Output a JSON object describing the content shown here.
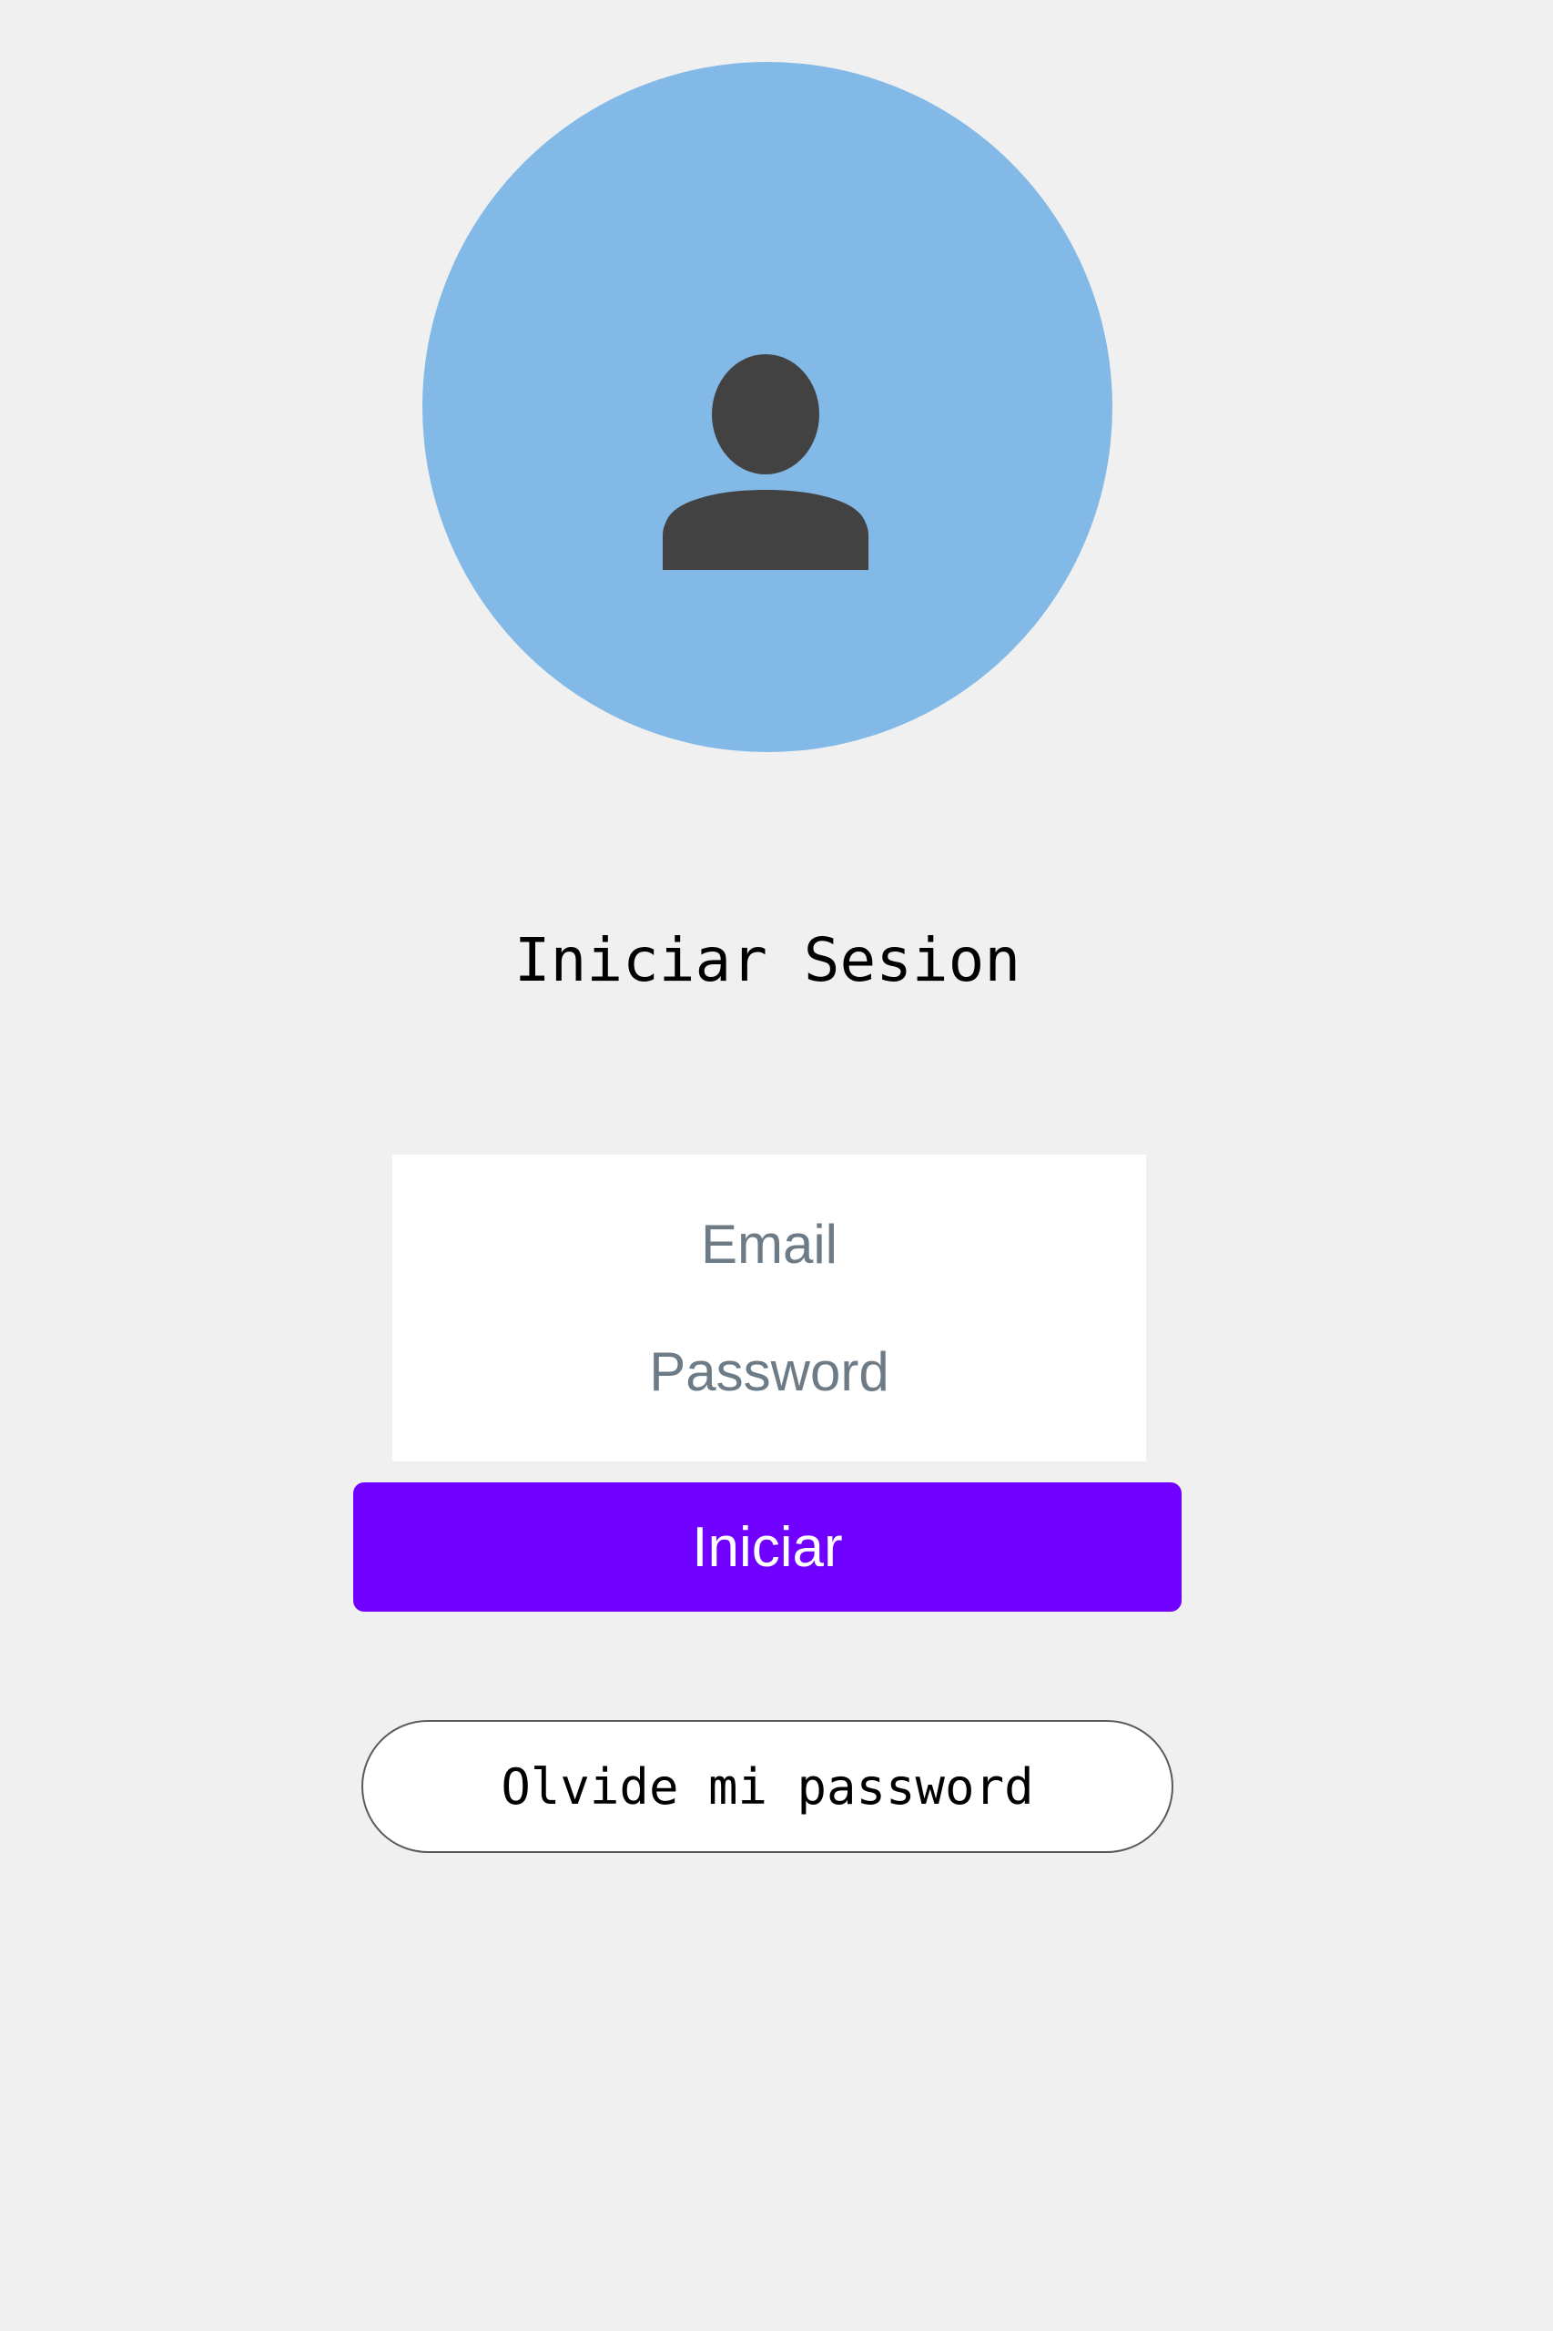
{
  "avatar": {
    "icon": "user-icon",
    "background_color": "#82b9e6",
    "icon_color": "#424242"
  },
  "login": {
    "title": "Iniciar Sesion",
    "email_placeholder": "Email",
    "email_value": "",
    "password_placeholder": "Password",
    "password_value": "",
    "submit_label": "Iniciar",
    "submit_color": "#7000ff",
    "forgot_label": "Olvide mi password"
  }
}
